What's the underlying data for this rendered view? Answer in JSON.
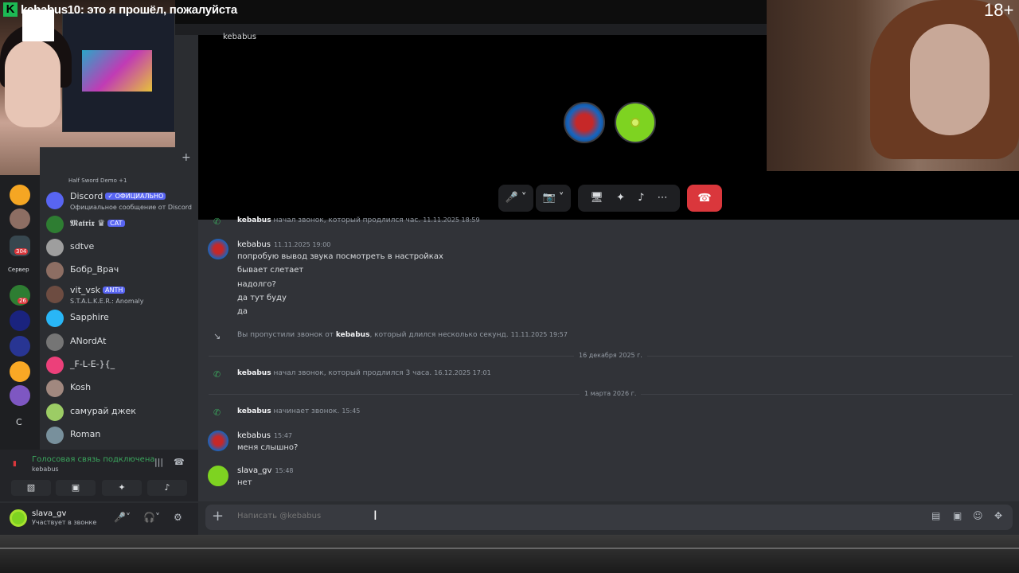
{
  "overlay": {
    "k_logo": "K",
    "donation_text": "kebabus10: это я прошёл, пожалуйста",
    "age_rating": "18+"
  },
  "call": {
    "participant_title": "kebabus",
    "controls": {
      "mic": "🎤",
      "camera": "📷",
      "screen_share": "🖥",
      "activities": "✦",
      "soundboard": "♪",
      "more": "⋯",
      "hangup": "☎"
    }
  },
  "dm_list": {
    "add_label": "+",
    "top_activity": "Half Sword Demo +1",
    "items": [
      {
        "name": "Discord",
        "tag": "✓ ОФИЦИАЛЬНО",
        "sub": "Официальное сообщение от Discord",
        "color": "#5865f2"
      },
      {
        "name": "𝕸𝖆𝖙𝖗𝖎𝖝 ♛",
        "tag": "CAT",
        "sub": "",
        "color": "#2e7d32"
      },
      {
        "name": "sdtve",
        "tag": "",
        "sub": "",
        "color": "#9e9e9e"
      },
      {
        "name": "Бобр_Врач",
        "tag": "",
        "sub": "",
        "color": "#8d6e63"
      },
      {
        "name": "vit_vsk",
        "tag": "ANTH",
        "sub": "S.T.A.L.K.E.R.: Anomaly",
        "color": "#6d4c41"
      },
      {
        "name": "Sapphire",
        "tag": "",
        "sub": "",
        "color": "#29b6f6"
      },
      {
        "name": "ANordAt",
        "tag": "",
        "sub": "",
        "color": "#757575"
      },
      {
        "name": "_F-L-E-}{_",
        "tag": "",
        "sub": "",
        "color": "#ec407a"
      },
      {
        "name": "Kosh",
        "tag": "",
        "sub": "",
        "color": "#a1887f"
      },
      {
        "name": "самурай джек",
        "tag": "",
        "sub": "",
        "color": "#9ccc65"
      },
      {
        "name": "Roman",
        "tag": "",
        "sub": "",
        "color": "#78909c"
      }
    ]
  },
  "servers": {
    "badge_304": "304",
    "badge_26": "26",
    "label_servers": "Сервер",
    "letter_c": "C"
  },
  "voice": {
    "status": "Голосовая связь подключена",
    "channel": "kebabus"
  },
  "user": {
    "name": "slava_gv",
    "status": "Участвует в звонке"
  },
  "chat": {
    "sys1": {
      "who": "kebabus",
      "text": " начал звонок, который продлился час.",
      "time": "11.11.2025 18:59"
    },
    "msg1": {
      "author": "kebabus",
      "time": "11.11.2025 19:00",
      "lines": [
        "попробую вывод звука посмотреть в настройках",
        "бывает слетает",
        "надолго?",
        "да тут буду",
        "да"
      ]
    },
    "sys2": {
      "pre": "Вы пропустили звонок от ",
      "who": "kebabus",
      "text": ", который длился несколько секунд.",
      "time": "11.11.2025 19:57"
    },
    "divider1": "16 декабря 2025 г.",
    "sys3": {
      "who": "kebabus",
      "text": " начал звонок, который продлился 3 часа.",
      "time": "16.12.2025 17:01"
    },
    "divider2": "1 марта 2026 г.",
    "sys4": {
      "who": "kebabus",
      "text": " начинает звонок.",
      "time": "15:45"
    },
    "msg2": {
      "author": "kebabus",
      "time": "15:47",
      "lines": [
        "меня слышно?"
      ]
    },
    "msg3": {
      "author": "slava_gv",
      "time": "15:48",
      "lines": [
        "нет"
      ]
    }
  },
  "composer": {
    "placeholder": "Написать @kebabus"
  }
}
